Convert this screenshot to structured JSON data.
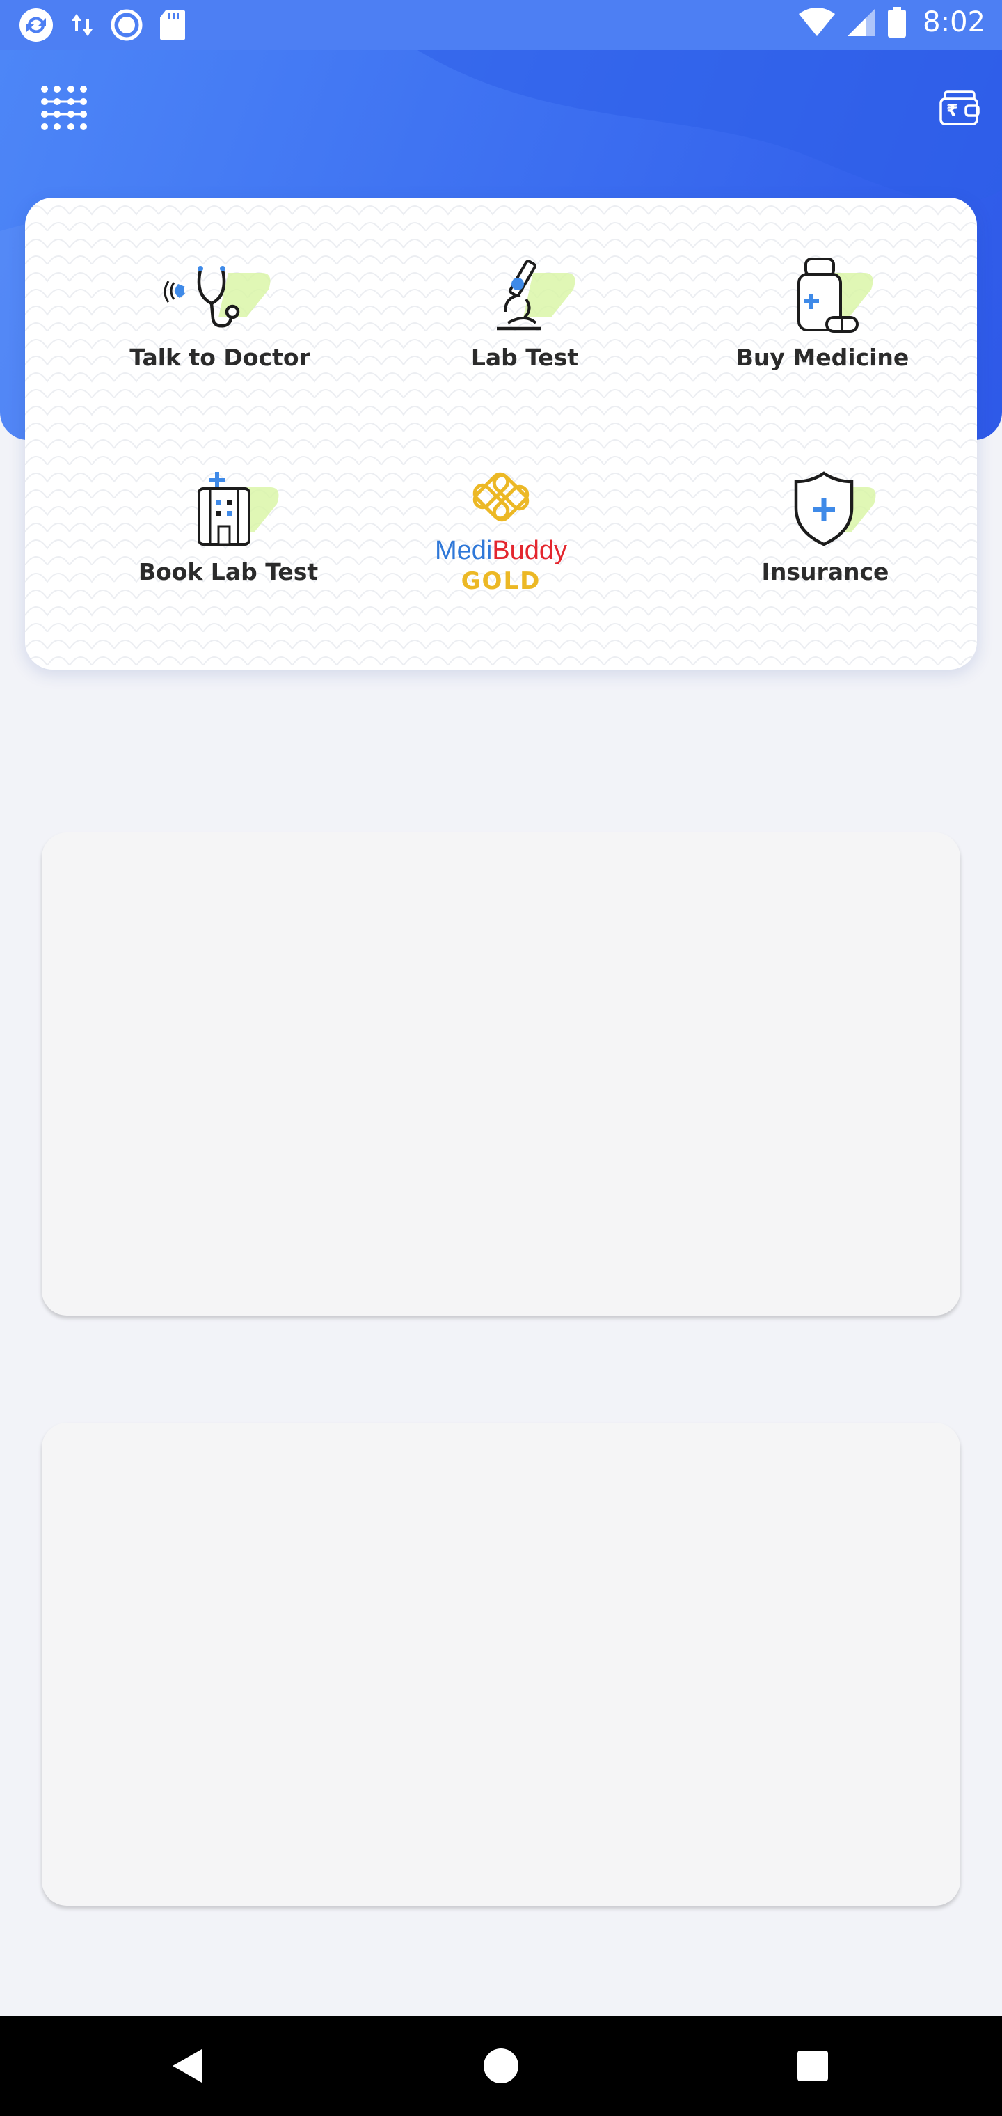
{
  "status_bar": {
    "time": "8:02"
  },
  "header": {
    "menu_icon": "grid-menu-icon",
    "wallet_icon": "wallet-icon",
    "wallet_currency_symbol": "₹"
  },
  "services": [
    {
      "label": "Talk to Doctor",
      "icon": "stethoscope-icon"
    },
    {
      "label": "Lab Test",
      "icon": "microscope-icon"
    },
    {
      "label": "Buy Medicine",
      "icon": "medicine-bottle-icon"
    },
    {
      "label": "Book Lab Test",
      "icon": "hospital-building-icon"
    },
    {
      "label": "Insurance",
      "icon": "shield-plus-icon"
    }
  ],
  "gold_banner": {
    "brand_medi": "Medi",
    "brand_buddy": "Buddy",
    "tier": "GOLD"
  },
  "colors": {
    "primary": "#3b6df0",
    "accent_green": "#d8f5a2",
    "gold": "#ecb825",
    "brand_red": "#e3262e",
    "brand_blue": "#2f78d8"
  },
  "nav_bar": {
    "back_icon": "back-triangle-icon",
    "home_icon": "home-circle-icon",
    "recents_icon": "recents-square-icon"
  }
}
